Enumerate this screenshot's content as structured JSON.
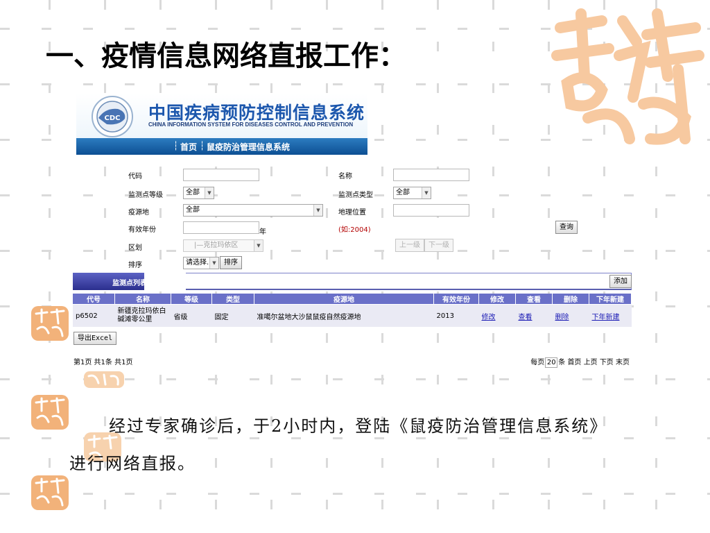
{
  "slide": {
    "title": "一、疫情信息网络直报工作：",
    "body_line1": "经过专家确诊后，于2小时内，登陆《鼠疫防治管理信息系统》",
    "body_line2": "进行网络直报。"
  },
  "decor": {
    "seal_color": "#f5c08c",
    "seal_icon": "auspicious-seal"
  },
  "system": {
    "logo_text": "CDC",
    "title": "中国疾病预防控制信息系统",
    "subtitle": "CHINA INFORMATION SYSTEM FOR DISEASES CONTROL AND PREVENTION",
    "nav": {
      "separator": "┆",
      "home": "首页",
      "module": "鼠疫防治管理信息系统"
    },
    "brand_color": "#1c57ad"
  },
  "search": {
    "code_label": "代码",
    "code_value": "",
    "name_label": "名称",
    "name_value": "",
    "level_label": "监测点等级",
    "level_value": "全部",
    "type_label": "监测点类型",
    "type_value": "全部",
    "focus_label": "疫源地",
    "focus_value": "全部",
    "location_label": "地理位置",
    "location_value": "",
    "year_label": "有效年份",
    "year_value": "",
    "year_unit": "年",
    "year_hint": "(如:2004)",
    "query_button": "查询",
    "region_label": "区划",
    "region_value": "|—克拉玛依区",
    "up_button": "上一级",
    "down_button": "下一级",
    "sort_label": "排序",
    "sort_value": "请选择...",
    "sort_button": "排序"
  },
  "list": {
    "panel_title": "监测点列表",
    "add_button": "添加",
    "columns": [
      "代号",
      "名称",
      "等级",
      "类型",
      "疫源地",
      "有效年份",
      "修改",
      "查看",
      "删除",
      "下年新建"
    ],
    "rows": [
      {
        "code": "p6502",
        "name": "新疆克拉玛依白碱滩零公里",
        "level": "省级",
        "type": "固定",
        "focus": "准噶尔盆地大沙鼠鼠疫自然疫源地",
        "year": "2013",
        "edit": "修改",
        "view": "查看",
        "delete": "删除",
        "next_year": "下年新建"
      }
    ],
    "export_button": "导出Excel",
    "pager_info": "第1页 共1条 共1页",
    "per_page_prefix": "每页",
    "per_page_value": "20",
    "per_page_suffix": "条",
    "first": "首页",
    "prev": "上页",
    "next": "下页",
    "last": "末页"
  }
}
